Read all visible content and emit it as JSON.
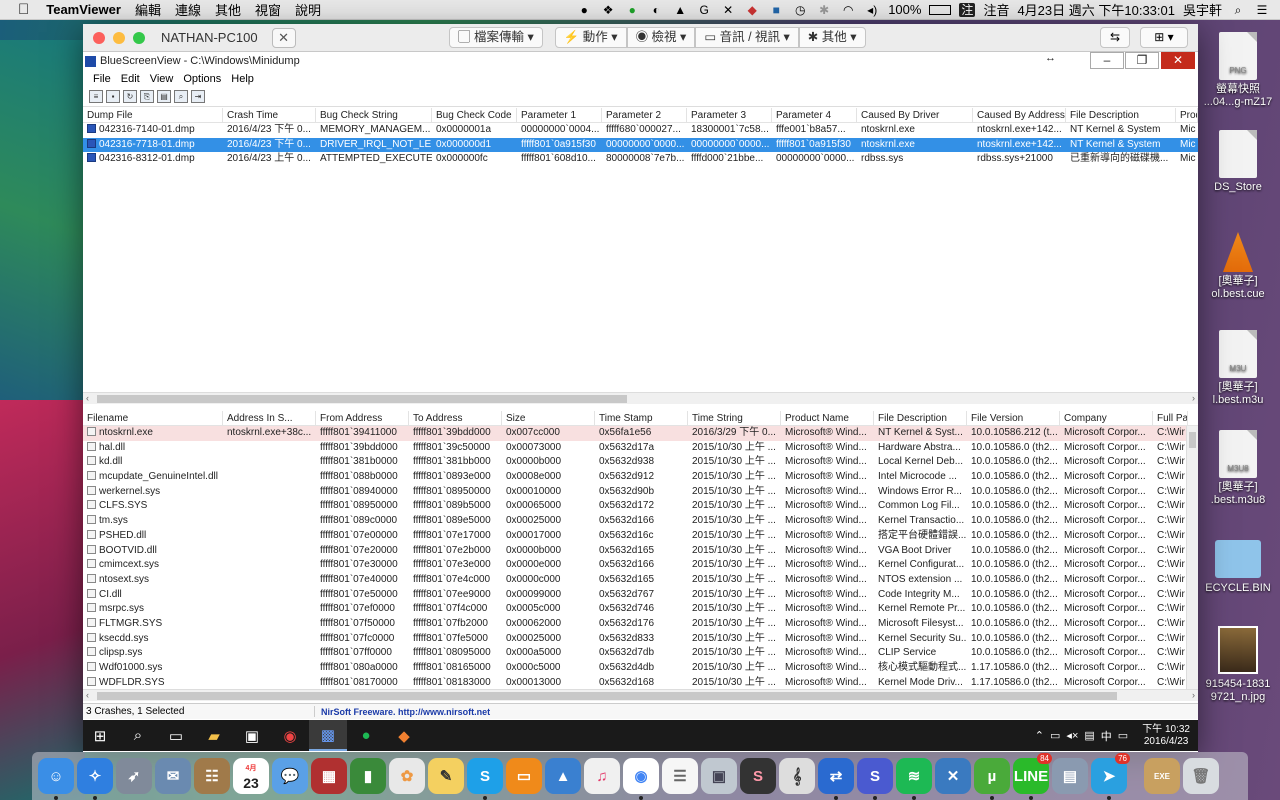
{
  "menubar": {
    "app": "TeamViewer",
    "items": [
      "編輯",
      "連線",
      "其他",
      "視窗",
      "說明"
    ],
    "battery": "100%",
    "input_method": "注音",
    "input_icon": "注",
    "datetime": "4月23日 週六 下午10:33:01",
    "user": "吳宇軒"
  },
  "teamviewer": {
    "title": "NATHAN-PC100",
    "buttons": [
      "檔案傳輸",
      "動作",
      "檢視",
      "音訊 / 視訊",
      "其他"
    ]
  },
  "bsv": {
    "title": "BlueScreenView  -  C:\\Windows\\Minidump",
    "menu": [
      "File",
      "Edit",
      "View",
      "Options",
      "Help"
    ],
    "top_columns": [
      "Dump File",
      "Crash Time",
      "Bug Check String",
      "Bug Check Code",
      "Parameter 1",
      "Parameter 2",
      "Parameter 3",
      "Parameter 4",
      "Caused By Driver",
      "Caused By Address",
      "File Description",
      "Prod"
    ],
    "crashes": [
      [
        "042316-7140-01.dmp",
        "2016/4/23 下午 0...",
        "MEMORY_MANAGEM...",
        "0x0000001a",
        "00000000`0004...",
        "fffff680`000027...",
        "18300001`7c58...",
        "fffe001`b8a57...",
        "ntoskrnl.exe",
        "ntoskrnl.exe+142...",
        "NT Kernel & System",
        "Mic"
      ],
      [
        "042316-7718-01.dmp",
        "2016/4/23 下午 0...",
        "DRIVER_IRQL_NOT_LE...",
        "0x000000d1",
        "fffff801`0a915f30",
        "00000000`0000...",
        "00000000`0000...",
        "fffff801`0a915f30",
        "ntoskrnl.exe",
        "ntoskrnl.exe+142...",
        "NT Kernel & System",
        "Mic"
      ],
      [
        "042316-8312-01.dmp",
        "2016/4/23 上午 0...",
        "ATTEMPTED_EXECUTE...",
        "0x000000fc",
        "fffff801`608d10...",
        "80000008`7e7b...",
        "ffffd000`21bbe...",
        "00000000`0000...",
        "rdbss.sys",
        "rdbss.sys+21000",
        "已重新導向的磁碟機...",
        "Mic"
      ]
    ],
    "bottom_columns": [
      "Filename",
      "Address In S...",
      "From Address",
      "To Address",
      "Size",
      "Time Stamp",
      "Time String",
      "Product Name",
      "File Description",
      "File Version",
      "Company",
      "Full Pa"
    ],
    "drivers": [
      [
        "ntoskrnl.exe",
        "ntoskrnl.exe+38c...",
        "fffff801`39411000",
        "fffff801`39bdd000",
        "0x007cc000",
        "0x56fa1e56",
        "2016/3/29 下午 0...",
        "Microsoft® Wind...",
        "NT Kernel & Syst...",
        "10.0.10586.212 (t...",
        "Microsoft Corpor...",
        "C:\\Wir"
      ],
      [
        "hal.dll",
        "",
        "fffff801`39bdd000",
        "fffff801`39c50000",
        "0x00073000",
        "0x5632d17a",
        "2015/10/30 上午 ...",
        "Microsoft® Wind...",
        "Hardware Abstra...",
        "10.0.10586.0 (th2...",
        "Microsoft Corpor...",
        "C:\\Wir"
      ],
      [
        "kd.dll",
        "",
        "fffff801`381b0000",
        "fffff801`381bb000",
        "0x0000b000",
        "0x5632d938",
        "2015/10/30 上午 ...",
        "Microsoft® Wind...",
        "Local Kernel Deb...",
        "10.0.10586.0 (th2...",
        "Microsoft Corpor...",
        "C:\\Wir"
      ],
      [
        "mcupdate_GenuineIntel.dll",
        "",
        "fffff801`088b0000",
        "fffff801`0893e000",
        "0x0008e000",
        "0x5632d912",
        "2015/10/30 上午 ...",
        "Microsoft® Wind...",
        "Intel Microcode ...",
        "10.0.10586.0 (th2...",
        "Microsoft Corpor...",
        "C:\\Wir"
      ],
      [
        "werkernel.sys",
        "",
        "fffff801`08940000",
        "fffff801`08950000",
        "0x00010000",
        "0x5632d90b",
        "2015/10/30 上午 ...",
        "Microsoft® Wind...",
        "Windows Error R...",
        "10.0.10586.0 (th2...",
        "Microsoft Corpor...",
        "C:\\Wir"
      ],
      [
        "CLFS.SYS",
        "",
        "fffff801`08950000",
        "fffff801`089b5000",
        "0x00065000",
        "0x5632d172",
        "2015/10/30 上午 ...",
        "Microsoft® Wind...",
        "Common Log Fil...",
        "10.0.10586.0 (th2...",
        "Microsoft Corpor...",
        "C:\\Wir"
      ],
      [
        "tm.sys",
        "",
        "fffff801`089c0000",
        "fffff801`089e5000",
        "0x00025000",
        "0x5632d166",
        "2015/10/30 上午 ...",
        "Microsoft® Wind...",
        "Kernel Transactio...",
        "10.0.10586.0 (th2...",
        "Microsoft Corpor...",
        "C:\\Wir"
      ],
      [
        "PSHED.dll",
        "",
        "fffff801`07e00000",
        "fffff801`07e17000",
        "0x00017000",
        "0x5632d16c",
        "2015/10/30 上午 ...",
        "Microsoft® Wind...",
        "搭定平台硬體錯誤...",
        "10.0.10586.0 (th2...",
        "Microsoft Corpor...",
        "C:\\Wir"
      ],
      [
        "BOOTVID.dll",
        "",
        "fffff801`07e20000",
        "fffff801`07e2b000",
        "0x0000b000",
        "0x5632d165",
        "2015/10/30 上午 ...",
        "Microsoft® Wind...",
        "VGA Boot Driver",
        "10.0.10586.0 (th2...",
        "Microsoft Corpor...",
        "C:\\Wir"
      ],
      [
        "cmimcext.sys",
        "",
        "fffff801`07e30000",
        "fffff801`07e3e000",
        "0x0000e000",
        "0x5632d166",
        "2015/10/30 上午 ...",
        "Microsoft® Wind...",
        "Kernel Configurat...",
        "10.0.10586.0 (th2...",
        "Microsoft Corpor...",
        "C:\\Wir"
      ],
      [
        "ntosext.sys",
        "",
        "fffff801`07e40000",
        "fffff801`07e4c000",
        "0x0000c000",
        "0x5632d165",
        "2015/10/30 上午 ...",
        "Microsoft® Wind...",
        "NTOS extension ...",
        "10.0.10586.0 (th2...",
        "Microsoft Corpor...",
        "C:\\Wir"
      ],
      [
        "CI.dll",
        "",
        "fffff801`07e50000",
        "fffff801`07ee9000",
        "0x00099000",
        "0x5632d767",
        "2015/10/30 上午 ...",
        "Microsoft® Wind...",
        "Code Integrity M...",
        "10.0.10586.0 (th2...",
        "Microsoft Corpor...",
        "C:\\Wir"
      ],
      [
        "msrpc.sys",
        "",
        "fffff801`07ef0000",
        "fffff801`07f4c000",
        "0x0005c000",
        "0x5632d746",
        "2015/10/30 上午 ...",
        "Microsoft® Wind...",
        "Kernel Remote Pr...",
        "10.0.10586.0 (th2...",
        "Microsoft Corpor...",
        "C:\\Wir"
      ],
      [
        "FLTMGR.SYS",
        "",
        "fffff801`07f50000",
        "fffff801`07fb2000",
        "0x00062000",
        "0x5632d176",
        "2015/10/30 上午 ...",
        "Microsoft® Wind...",
        "Microsoft Filesyst...",
        "10.0.10586.0 (th2...",
        "Microsoft Corpor...",
        "C:\\Wir"
      ],
      [
        "ksecdd.sys",
        "",
        "fffff801`07fc0000",
        "fffff801`07fe5000",
        "0x00025000",
        "0x5632d833",
        "2015/10/30 上午 ...",
        "Microsoft® Wind...",
        "Kernel Security Su...",
        "10.0.10586.0 (th2...",
        "Microsoft Corpor...",
        "C:\\Wir"
      ],
      [
        "clipsp.sys",
        "",
        "fffff801`07ff0000",
        "fffff801`08095000",
        "0x000a5000",
        "0x5632d7db",
        "2015/10/30 上午 ...",
        "Microsoft® Wind...",
        "CLIP Service",
        "10.0.10586.0 (th2...",
        "Microsoft Corpor...",
        "C:\\Wir"
      ],
      [
        "Wdf01000.sys",
        "",
        "fffff801`080a0000",
        "fffff801`08165000",
        "0x000c5000",
        "0x5632d4db",
        "2015/10/30 上午 ...",
        "Microsoft® Wind...",
        "核心模式驅動程式...",
        "1.17.10586.0 (th2...",
        "Microsoft Corpor...",
        "C:\\Wir"
      ],
      [
        "WDFLDR.SYS",
        "",
        "fffff801`08170000",
        "fffff801`08183000",
        "0x00013000",
        "0x5632d168",
        "2015/10/30 上午 ...",
        "Microsoft® Wind...",
        "Kernel Mode Driv...",
        "1.17.10586.0 (th2...",
        "Microsoft Corpor...",
        "C:\\Wir"
      ]
    ],
    "status_count": "3 Crashes, 1 Selected",
    "status_link": "NirSoft Freeware.  http://www.nirsoft.net"
  },
  "wintaskbar": {
    "time": "下午 10:32",
    "date": "2016/4/23",
    "ime": "中"
  },
  "desktop": {
    "icons": [
      {
        "name": "螢幕快照\n...04...g-mZ17",
        "doc": "PNG"
      },
      {
        "name": "DS_Store",
        "doc": ""
      },
      {
        "name": "[奧華子]\nol.best.cue",
        "doc": ""
      },
      {
        "name": "[奧華子]\nl.best.m3u",
        "doc": "M3U"
      },
      {
        "name": "[奧華子]\n.best.m3u8",
        "doc": "M3U8"
      },
      {
        "name": "ECYCLE.BIN",
        "doc": ""
      },
      {
        "name": "915454-1831\n9721_n.jpg",
        "doc": ""
      }
    ]
  },
  "dock": {
    "calendar_day": "23",
    "calendar_month": "4月",
    "line_badge": "84",
    "telegram_badge": "76",
    "exe_label": "EXE"
  },
  "colors": {
    "selection": "#3390e6",
    "highlight_row": "#f8e0e0",
    "menubar": "#e8e8e8"
  }
}
